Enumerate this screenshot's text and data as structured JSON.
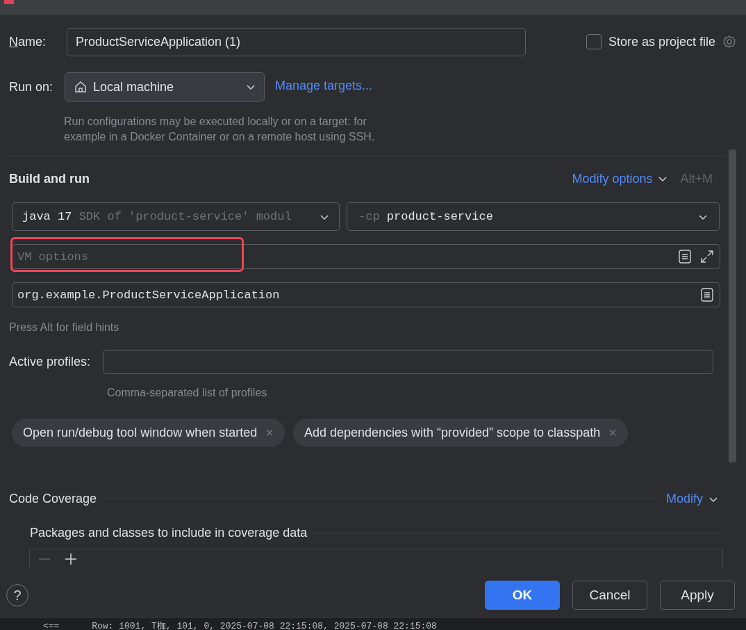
{
  "name_field": {
    "label": "Name:",
    "value": "ProductServiceApplication (1)"
  },
  "store_as_project_file": {
    "label": "Store as project file",
    "checked": false
  },
  "run_on": {
    "label": "Run on:",
    "value": "Local machine",
    "link": "Manage targets...",
    "hint": "Run configurations may be executed locally or on a target: for example in a Docker Container or on a remote host using SSH."
  },
  "build_and_run": {
    "title": "Build and run",
    "modify": "Modify options",
    "shortcut": "Alt+M",
    "sdk": {
      "value": "java 17",
      "detail": "SDK of 'product-service' modul"
    },
    "classpath": {
      "flag": "-cp",
      "value": "product-service"
    },
    "vm_options": {
      "placeholder": "VM options",
      "highlighted": true
    },
    "main_class": "org.example.ProductServiceApplication",
    "hint": "Press Alt for field hints"
  },
  "active_profiles": {
    "label": "Active profiles:",
    "hint": "Comma-separated list of profiles"
  },
  "chips": [
    {
      "label": "Open run/debug tool window when started",
      "close": "×"
    },
    {
      "label": "Add dependencies with “provided” scope to classpath",
      "close": "×"
    }
  ],
  "code_coverage": {
    "title": "Code Coverage",
    "modify": "Modify",
    "packages_title": "Packages and classes to include in coverage data"
  },
  "buttons": [
    {
      "label": "OK",
      "primary": true
    },
    {
      "label": "Cancel",
      "primary": false
    },
    {
      "label": "Apply",
      "primary": false
    }
  ],
  "help": "?",
  "console_line": "<==      Row: 1001, T枷, 101, 0, 2025-07-08 22:15:08, 2025-07-08 22:15:08"
}
